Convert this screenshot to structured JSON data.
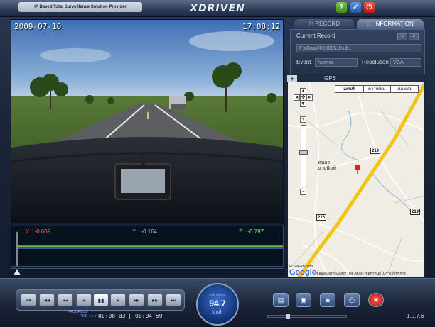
{
  "app": {
    "tagline": "IP Based Total Surveillance Solution Provider",
    "logo": "XDRIVEN",
    "help_label": "?",
    "min_label": "✓",
    "power_label": "⏻",
    "version": "1.0.7.6"
  },
  "video": {
    "date": "2009-07-10",
    "time": "17:08:12"
  },
  "graph": {
    "x_label": "X",
    "x_value": ": -0.609",
    "y_label": "Y",
    "y_value": ": -0.164",
    "z_label": "Z",
    "z_value": ": -0.797",
    "colors": {
      "x": "#ff3a2a",
      "y": "#3a8aff",
      "z": "#3aff3a"
    }
  },
  "tabs": {
    "record": "RECORD",
    "information": "INFORMATION"
  },
  "info": {
    "current_record_label": "Current Record",
    "current_record_value": "F:¥Data¥00000510.ub1",
    "event_label": "Event",
    "event_value": "Normal",
    "resolution_label": "Resolution",
    "resolution_value": "VGA",
    "prev_label": "<",
    "next_label": ">"
  },
  "gps": {
    "plus_label": "+",
    "label": "GPS"
  },
  "map": {
    "type_map": "แผนที่",
    "type_satellite": "ดาวเทียม",
    "type_hybrid": "แบบผสม",
    "town_name_1": "หนอง",
    "town_name_2": "ยายพิมพ์",
    "road_1": "219",
    "road_2": "219",
    "road_3": "216",
    "powered_by": "POWERED BY",
    "google": "Google",
    "copyright": "ข้อมูลแผนที่ ©2009 Tele Atlas - ข้อกำหนดในการใช้บริการ",
    "zoom_in": "+",
    "zoom_out": "−"
  },
  "controls": {
    "buttons": [
      "⏮",
      "◂◂",
      "◂◂",
      "◂",
      "▮▮",
      "▸",
      "▸▸",
      "▸▸",
      "⏭"
    ],
    "progress_label_1": "PROGRESS",
    "progress_label_2": "TIME",
    "play_indicator": "▸▸▸",
    "elapsed": "00:00:03",
    "total": "00:04:59",
    "divider": "|"
  },
  "speed": {
    "label": "CAR SPEED",
    "value": "94.7",
    "unit": "km/h"
  },
  "tools": {
    "icons": [
      "book-icon",
      "save-icon",
      "camera-icon",
      "print-icon",
      "wrench-icon"
    ],
    "glyphs": [
      "▤",
      "▣",
      "◙",
      "⎙",
      "✖"
    ]
  }
}
